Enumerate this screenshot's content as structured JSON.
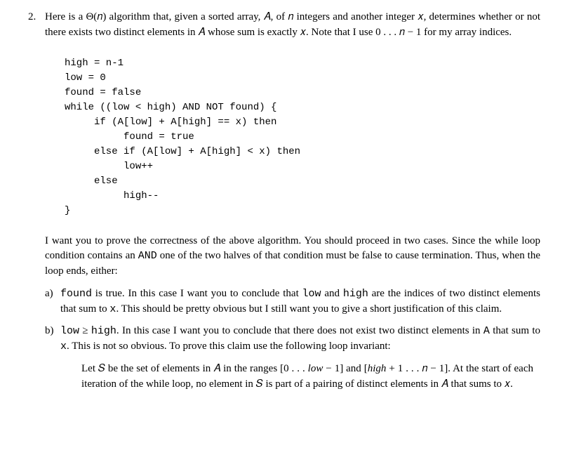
{
  "problem": {
    "number": "2.",
    "intro": "Here is a Θ(𝑛) algorithm that, given a sorted array, 𝐴, of 𝑛 integers and another integer 𝑥, determines whether or not there exists two distinct elements in 𝐴 whose sum is exactly 𝑥.  Note that I use 0 . . . 𝑛 − 1 for my array indices.",
    "code": "high = n-1\nlow = 0\nfound = false\nwhile ((low < high) AND NOT found) {\n     if (A[low] + A[high] == x) then\n          found = true\n     else if (A[low] + A[high] < x) then\n          low++\n     else\n          high--\n}",
    "proof_intro_1": "I want you to prove the correctness of the above algorithm. You should proceed in two cases. Since the while loop condition contains an ",
    "proof_intro_and": "AND",
    "proof_intro_2": " one of the two halves of that condition must be false to cause termination. Thus, when the loop ends, either:",
    "case_a": {
      "label": "a)",
      "t1": "found",
      "t2": " is true.  In this case I want you to conclude that ",
      "t3": "low",
      "t4": " and ",
      "t5": "high",
      "t6": " are the indices of two distinct elements that sum to ",
      "t7": "x",
      "t8": ". This should be pretty obvious but I still want you to give a short justification of this claim."
    },
    "case_b": {
      "label": "b)",
      "t1": "low",
      "t2": " ≥ ",
      "t3": "high",
      "t4": ". In this case I want you to conclude that there does not exist two distinct elements in ",
      "t5": "A",
      "t6": " that sum to ",
      "t7": "x",
      "t8": ". This is not so obvious. To prove this claim use the following loop invariant:",
      "inv1": "Let 𝑆 be the set of elements in 𝐴 in the ranges [0 . . . ",
      "inv2": "low",
      "inv3": " − 1] and [",
      "inv4": "high",
      "inv5": " + 1 . . . 𝑛 − 1]. At the start of each iteration of the while loop, no element in 𝑆 is part of a pairing of distinct elements in 𝐴 that sums to 𝑥."
    }
  }
}
